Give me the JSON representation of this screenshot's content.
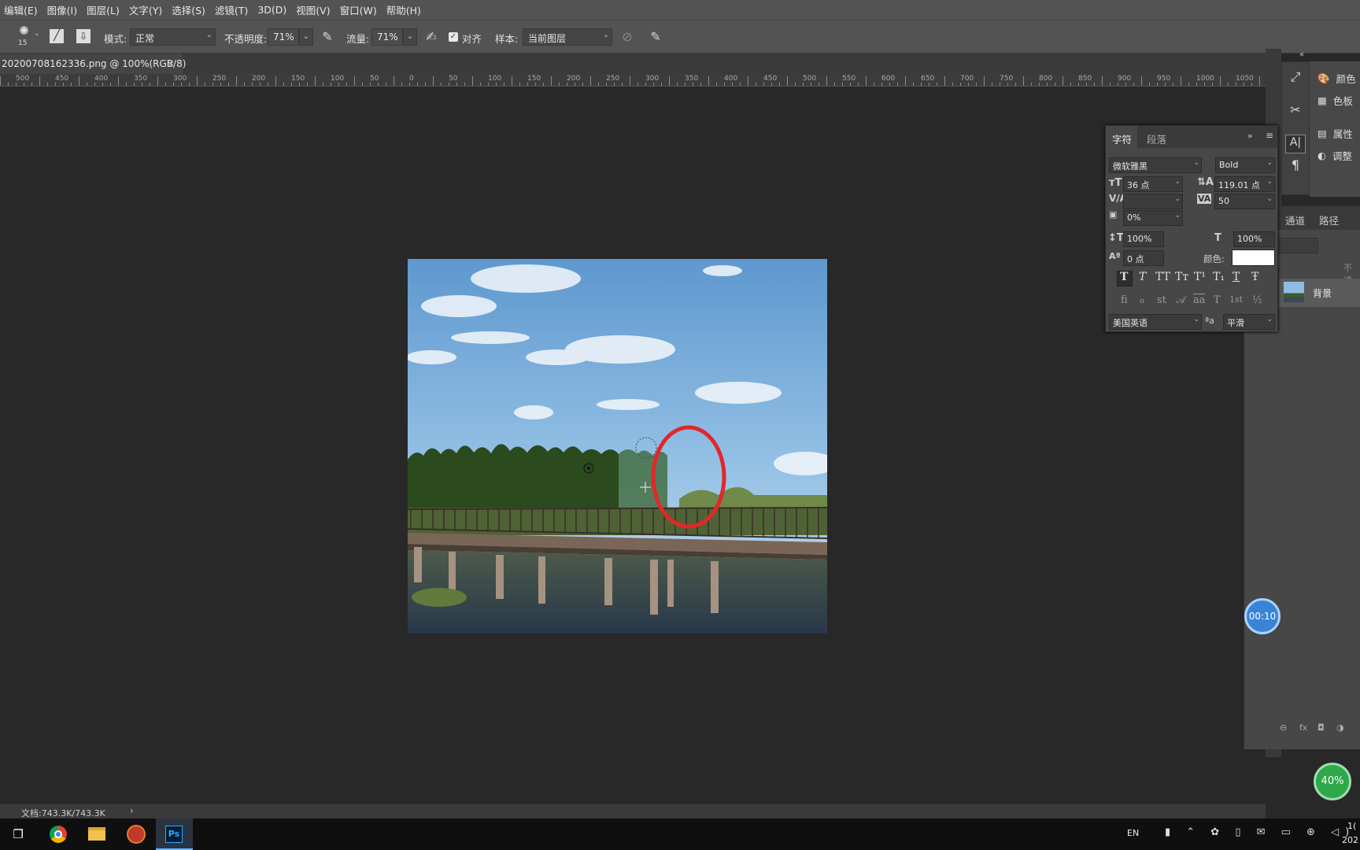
{
  "menu": [
    "编辑(E)",
    "图像(I)",
    "图层(L)",
    "文字(Y)",
    "选择(S)",
    "滤镜(T)",
    "3D(D)",
    "视图(V)",
    "窗口(W)",
    "帮助(H)"
  ],
  "options": {
    "brush_size": "15",
    "mode_label": "模式:",
    "mode_value": "正常",
    "opacity_label": "不透明度:",
    "opacity_value": "71%",
    "flow_label": "流量:",
    "flow_value": "71%",
    "align_label": "对齐",
    "sample_label": "样本:",
    "sample_value": "当前图层"
  },
  "document": {
    "tab_title": "20200708162336.png @ 100%(RGB/8)",
    "close": "×"
  },
  "ruler_labels": [
    "500",
    "450",
    "400",
    "350",
    "300",
    "250",
    "200",
    "150",
    "100",
    "50",
    "0",
    "50",
    "100",
    "150",
    "200",
    "250",
    "300",
    "350",
    "400",
    "450",
    "500",
    "550",
    "600",
    "650",
    "700",
    "750",
    "800",
    "850",
    "900",
    "950",
    "1000",
    "1050"
  ],
  "status": {
    "doc_size": "文档:743.3K/743.3K",
    "arrow": "›"
  },
  "right_panel": {
    "color": "颜色",
    "swatches": "色板",
    "properties": "属性",
    "adjustments": "调整",
    "collapse": "«"
  },
  "character_panel": {
    "tab_character": "字符",
    "tab_paragraph": "段落",
    "font_family": "微软雅黑",
    "font_style": "Bold",
    "font_size": "36 点",
    "leading": "119.01 点",
    "kerning": "",
    "tracking": "50",
    "tsume": "0%",
    "vertical_scale": "100%",
    "horizontal_scale": "100%",
    "baseline_shift": "0 点",
    "color_label": "颜色:",
    "language": "美国英语",
    "antialias_label": "ªa",
    "antialias": "平滑",
    "style_buttons": [
      "T",
      "T",
      "TT",
      "Tт",
      "T¹",
      "T₁",
      "T",
      "Ŧ"
    ],
    "opentype_buttons": [
      "fi",
      "ℴ",
      "st",
      "𝒜",
      "aa",
      "T",
      "1st",
      "½"
    ]
  },
  "layers_panel": {
    "tab_channels": "通道",
    "tab_paths": "路径",
    "opacity_label": "不透",
    "layer_name": "背景"
  },
  "overlays": {
    "timer": "00:10",
    "percent": "40%"
  },
  "taskbar": {
    "lang": "EN",
    "clock_time": "1(",
    "clock_date": "202"
  },
  "colors": {
    "highlight_circle": "#e0282a",
    "char_color_swatch": "#ffffff"
  }
}
